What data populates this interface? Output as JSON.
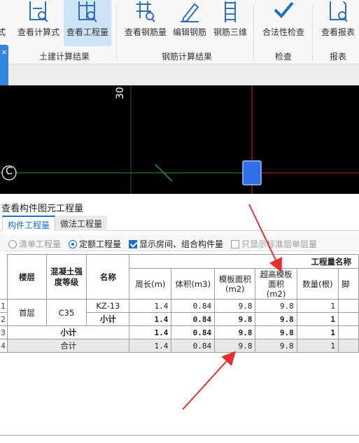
{
  "ribbon": {
    "buttons": [
      {
        "label": "查看计算式",
        "icon": "formula-icon"
      },
      {
        "label": "查看工程量",
        "icon": "table-search-icon"
      },
      {
        "label": "查看钢筋量",
        "icon": "rebar-search-icon"
      },
      {
        "label": "编辑钢筋",
        "icon": "pencil-icon"
      },
      {
        "label": "钢筋三维",
        "icon": "rebar-3d-icon"
      },
      {
        "label": "合法性检查",
        "icon": "checkmark-icon"
      },
      {
        "label": "查看报表",
        "icon": "report-icon"
      }
    ],
    "cut_left_label": "式",
    "groups": {
      "civil": "土建计算结果",
      "rebar": "钢筋计算结果",
      "check": "检查",
      "report": "报表"
    }
  },
  "side_tab": {
    "close": "×"
  },
  "canvas": {
    "axis_label_c": "C",
    "dim_label": "30"
  },
  "panel": {
    "title": "查看构件图元工程量",
    "tabs": [
      "构件工程量",
      "做法工程量"
    ],
    "options": {
      "list_qty": "清单工程量",
      "quota_qty": "定额工程量",
      "show_rooms": "显示房间、组合构件量",
      "only_std_floor": "只显示标准层单层量"
    }
  },
  "table": {
    "headers": {
      "floor": "楼层",
      "concrete_grade": "混凝土强度等级",
      "name": "名称",
      "group": "工程量名称",
      "perimeter": "周长(m)",
      "volume": "体积(m3)",
      "formwork_area": "模板面积(m2)",
      "high_formwork_area": "超高模板面积(m2)",
      "count": "数量(根)",
      "cut_col": "脚"
    },
    "row_numbers": [
      "1",
      "2",
      "3",
      "4"
    ],
    "rows": {
      "r1": {
        "floor": "首层",
        "grade": "C35",
        "name": "KZ-13",
        "perimeter": "1.4",
        "volume": "0.84",
        "formwork": "9.8",
        "high_formwork": "9.8",
        "count": "1"
      },
      "r2": {
        "name": "小计",
        "perimeter": "1.4",
        "volume": "0.84",
        "formwork": "9.8",
        "high_formwork": "9.8",
        "count": "1"
      },
      "r3": {
        "label": "小计",
        "perimeter": "1.4",
        "volume": "0.84",
        "formwork": "9.8",
        "high_formwork": "9.8",
        "count": "1"
      },
      "r4": {
        "label": "合计",
        "perimeter": "1.4",
        "volume": "0.84",
        "formwork": "9.8",
        "high_formwork": "9.8",
        "count": "1"
      }
    }
  },
  "colors": {
    "accent": "#1a6fc9",
    "canvas_bg": "#000000",
    "axis_red": "#e0242a",
    "axis_green": "#1f9a3a",
    "column_blue": "#2f6fe8",
    "annotation_arrow": "#e53030"
  }
}
